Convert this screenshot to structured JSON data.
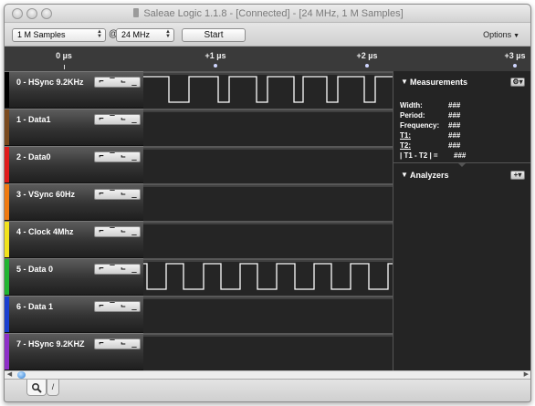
{
  "window": {
    "title": "Saleae Logic 1.1.8 - [Connected] - [24 MHz, 1 M Samples]"
  },
  "toolbar": {
    "samples": "1 M Samples",
    "at": "@",
    "rate": "24 MHz",
    "start_label": "Start",
    "options_label": "Options"
  },
  "ruler": {
    "labels": [
      "0 µs",
      "+1 µs",
      "+2 µs",
      "+3 µs"
    ]
  },
  "channels": [
    {
      "label": "0 - HSync 9.2KHz",
      "color": "#000000"
    },
    {
      "label": "1 - Data1",
      "color": "#7a4a1e"
    },
    {
      "label": "2 - Data0",
      "color": "#e01b1b"
    },
    {
      "label": "3 - VSync 60Hz",
      "color": "#f07a10"
    },
    {
      "label": "4 - Clock 4Mhz",
      "color": "#f1e21c"
    },
    {
      "label": "5 - Data 0",
      "color": "#21b531"
    },
    {
      "label": "6 - Data 1",
      "color": "#1a3fd0"
    },
    {
      "label": "7 - HSync 9.2KHZ",
      "color": "#8e2fc8"
    }
  ],
  "trigger_icons": [
    "rising-edge-icon",
    "high-level-icon",
    "falling-edge-icon",
    "low-level-icon"
  ],
  "measurements": {
    "header": "Measurements",
    "rows": [
      {
        "label": "Width:",
        "value": "###"
      },
      {
        "label": "Period:",
        "value": "###"
      },
      {
        "label": "Frequency:",
        "value": "###"
      },
      {
        "label": "T1:",
        "value": "###"
      },
      {
        "label": "T2:",
        "value": "###"
      },
      {
        "label": "| T1 - T2 | =",
        "value": "###"
      }
    ]
  },
  "analyzers": {
    "header": "Analyzers"
  },
  "colors": {
    "wave": "#ffffff",
    "background": "#252525"
  }
}
